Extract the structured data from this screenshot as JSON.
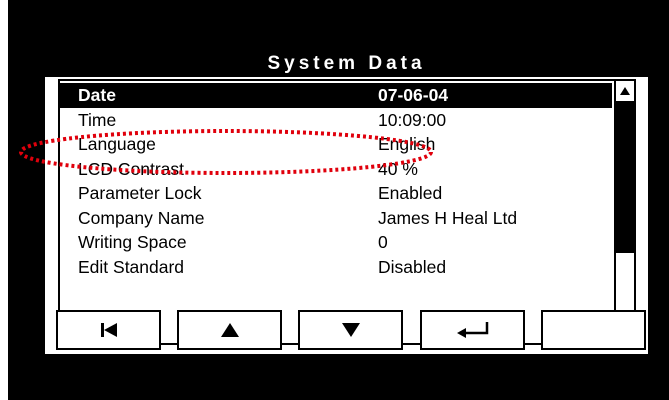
{
  "screen": {
    "title": "System Data",
    "rows": [
      {
        "label": "Date",
        "value": "07-06-04",
        "selected": true
      },
      {
        "label": "Time",
        "value": "10:09:00"
      },
      {
        "label": "Language",
        "value": "English"
      },
      {
        "label": "LCD Contrast",
        "value": "40 %"
      },
      {
        "label": "Parameter Lock",
        "value": "Enabled"
      },
      {
        "label": "Company Name",
        "value": "James H Heal Ltd"
      },
      {
        "label": "Writing Space",
        "value": "0"
      },
      {
        "label": "Edit Standard",
        "value": "Disabled"
      }
    ],
    "scrollbar": {
      "position": 0.0
    }
  },
  "softkeys": [
    {
      "icon": "first-page-icon"
    },
    {
      "icon": "arrow-up-icon"
    },
    {
      "icon": "arrow-down-icon"
    },
    {
      "icon": "enter-icon"
    },
    {
      "icon": ""
    }
  ],
  "colors": {
    "background": "#000000",
    "screen": "#ffffff",
    "highlight_ring": "#e0000c"
  }
}
